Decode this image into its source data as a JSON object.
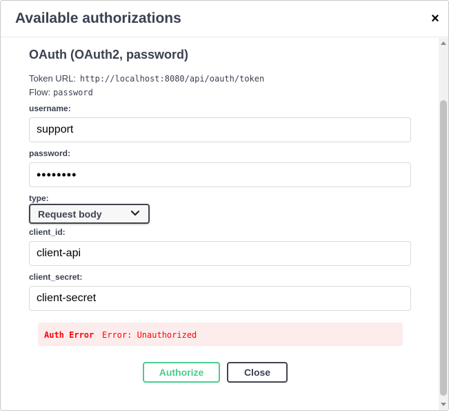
{
  "dialog": {
    "title": "Available authorizations",
    "close_glyph": "×"
  },
  "scheme": {
    "title": "OAuth (OAuth2, password)",
    "token_url_label": "Token URL:",
    "token_url": "http://localhost:8080/api/oauth/token",
    "flow_label": "Flow:",
    "flow": "password"
  },
  "fields": {
    "username": {
      "label": "username:",
      "value": "support"
    },
    "password": {
      "label": "password:",
      "value": "••••••••"
    },
    "type": {
      "label": "type:",
      "value": "Request body",
      "icon": "chevron-down-icon"
    },
    "client_id": {
      "label": "client_id:",
      "value": "client-api"
    },
    "client_secret": {
      "label": "client_secret:",
      "value": "client-secret"
    }
  },
  "error": {
    "label": "Auth Error",
    "message": "Error: Unauthorized",
    "color": "#ff0000",
    "background": "#fdecec"
  },
  "buttons": {
    "authorize": "Authorize",
    "close": "Close"
  },
  "colors": {
    "authorize_accent": "#49cc90",
    "text": "#3b4151"
  }
}
